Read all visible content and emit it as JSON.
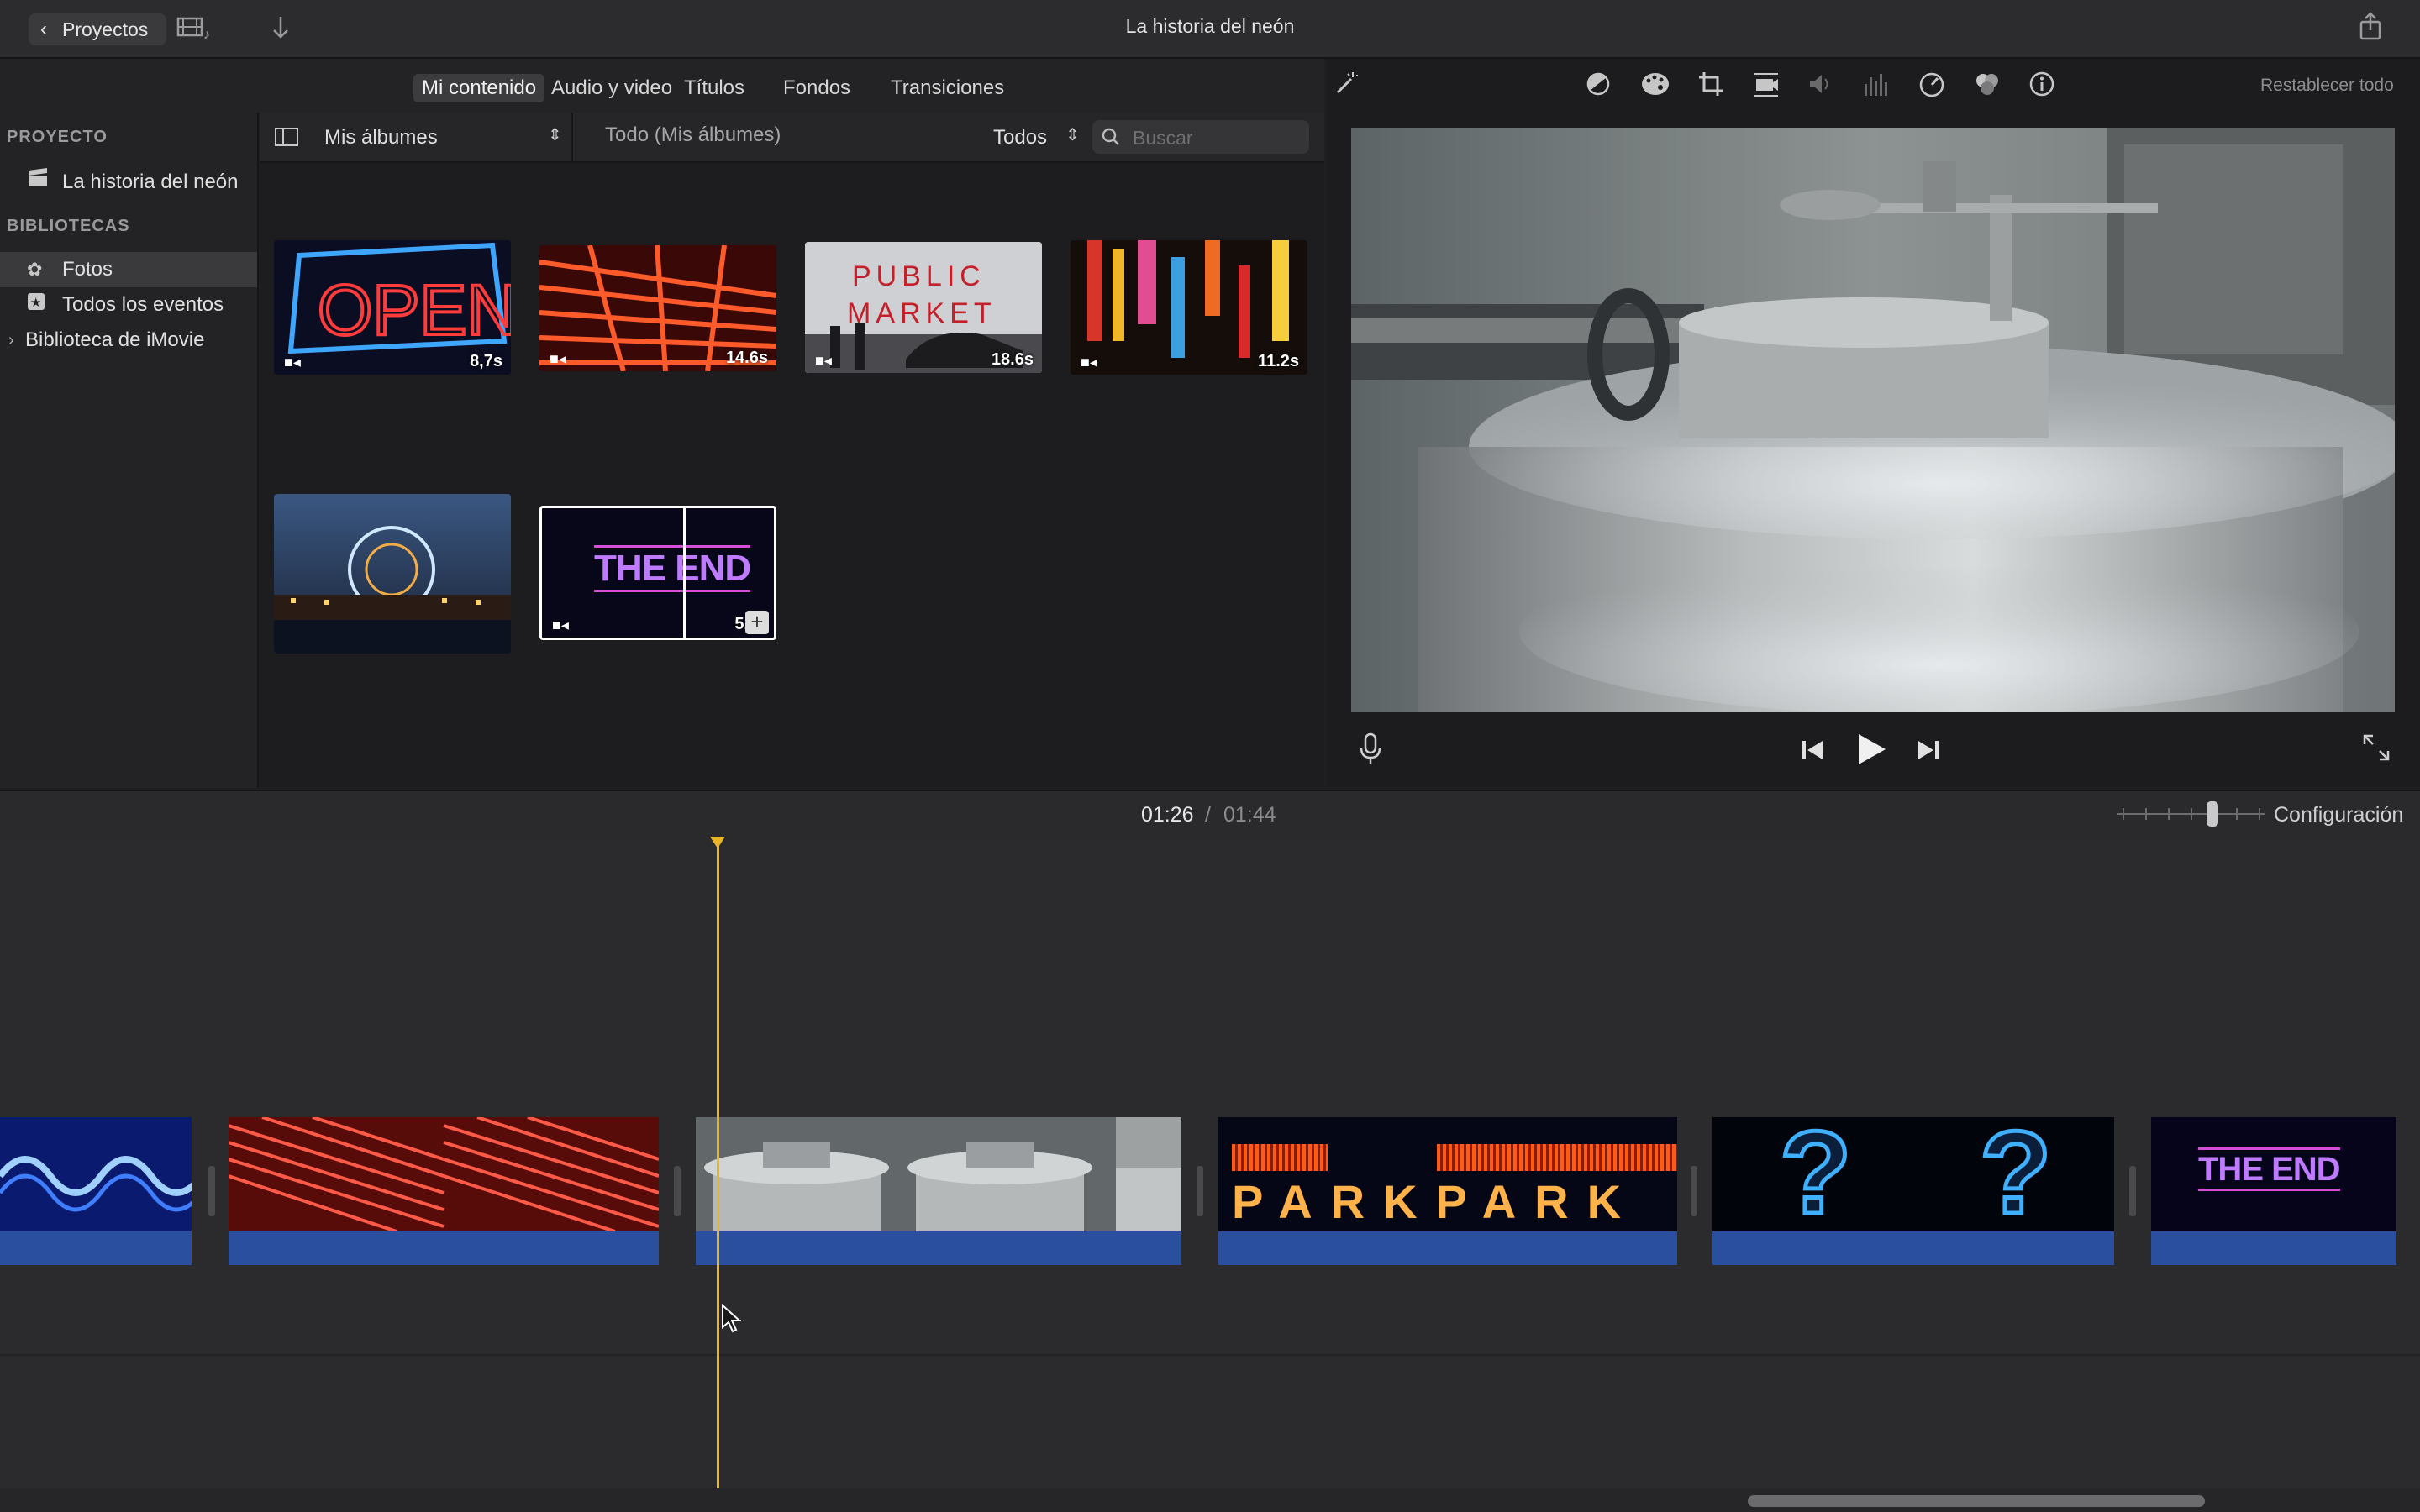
{
  "titlebar": {
    "back_label": "Proyectos",
    "window_title": "La historia del neón",
    "icons": [
      "back-chevron-icon",
      "media-toggle-icon",
      "import-arrow-icon",
      "share-icon"
    ]
  },
  "media_tabs": [
    {
      "label": "Mi contenido",
      "selected": true
    },
    {
      "label": "Audio y video",
      "selected": false
    },
    {
      "label": "Títulos",
      "selected": false
    },
    {
      "label": "Fondos",
      "selected": false
    },
    {
      "label": "Transiciones",
      "selected": false
    }
  ],
  "sidebar": {
    "project_header": "PROYECTO",
    "project_item": "La historia del neón",
    "libraries_header": "BIBLIOTECAS",
    "items": [
      {
        "label": "Fotos",
        "selected": true
      },
      {
        "label": "Todos los eventos",
        "selected": false
      },
      {
        "label": "Biblioteca de iMovie",
        "selected": false
      }
    ]
  },
  "browser": {
    "album_selector": "Mis álbumes",
    "breadcrumb": "Todo (Mis álbumes)",
    "filter": "Todos",
    "search_placeholder": "Buscar",
    "clips": [
      {
        "name": "open-sign",
        "duration": "8,7s"
      },
      {
        "name": "red-neon",
        "duration": "14.6s"
      },
      {
        "name": "public-market",
        "duration": "18.6s"
      },
      {
        "name": "city-night",
        "duration": "11.2s"
      },
      {
        "name": "ferris-wheel",
        "duration": ""
      },
      {
        "name": "the-end",
        "duration": "5.",
        "text": "THE END"
      }
    ]
  },
  "viewer": {
    "reset_label": "Restablecer todo",
    "tools": [
      "magic-wand-icon",
      "color-balance-icon",
      "color-palette-icon",
      "crop-icon",
      "stabilization-icon",
      "volume-icon",
      "equalizer-icon",
      "speed-icon",
      "filter-icon",
      "info-icon"
    ]
  },
  "timeline": {
    "current_time": "01:26",
    "separator": "/",
    "total_time": "01:44",
    "settings_label": "Configuración",
    "clip_park_text": "PARKPARK",
    "clip_q": "?",
    "clip_end_text": "THE END"
  },
  "colors": {
    "accent": "#e9b526",
    "audio_bar": "#2a4f9e",
    "selection": "#3a3a3c"
  }
}
